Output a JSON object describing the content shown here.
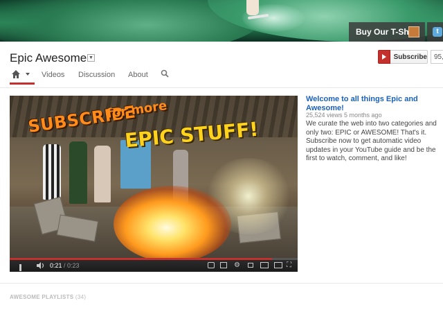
{
  "banner": {
    "tshirt_label": "Buy Our T-Shirt"
  },
  "channel": {
    "title": "Epic Awesome",
    "subscribe_label": "Subscribe",
    "subscriber_count": "95,"
  },
  "nav": {
    "tabs": [
      "Videos",
      "Discussion",
      "About"
    ]
  },
  "video": {
    "overlay_line1": "SUBSCRIBE",
    "overlay_line2": "for more",
    "overlay_line3": "EPIC STUFF!",
    "current_time": "0:21",
    "duration": "/ 0:23",
    "progress_fraction": 0.91
  },
  "description": {
    "title": "Welcome to all things Epic and Awesome!",
    "meta": "25,524 views   5 months ago",
    "body": "We curate the web into two categories and only two: EPIC or AWESOME! That's it. Subscribe now to get automatic video updates in your YouTube guide and be the first to watch, comment, and like!"
  },
  "playlists": {
    "label": "AWESOME PLAYLISTS",
    "count": "(34)"
  },
  "colors": {
    "accent": "#c4302b",
    "link": "#1c62b9"
  }
}
